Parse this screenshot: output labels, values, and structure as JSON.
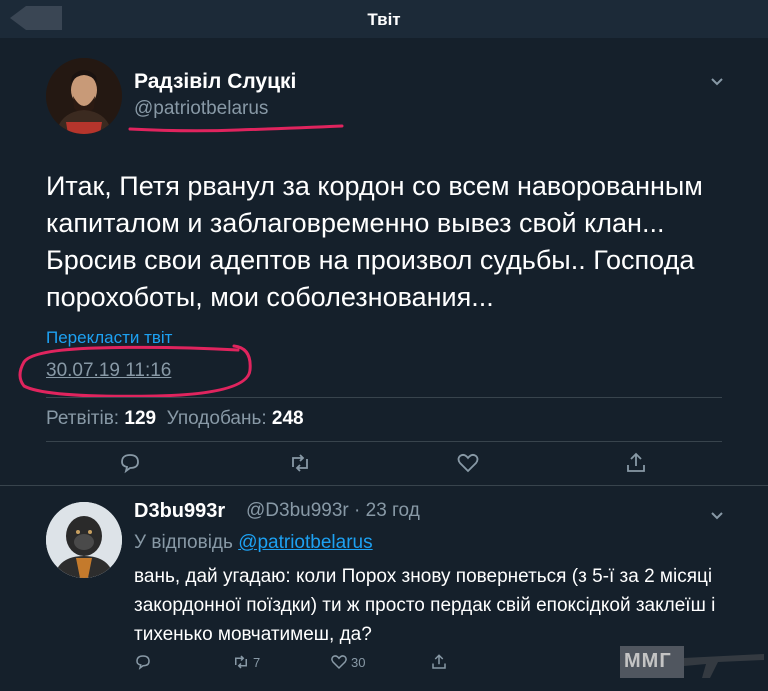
{
  "header": {
    "title": "Твіт"
  },
  "tweet": {
    "author_name": "Радзівіл Слуцкі",
    "author_handle": "@patriotbelarus",
    "text": "Итак, Петя рванул за кордон со всем наворованным капиталом и заблаговременно вывез свой клан... Бросив свои адептов на произвол судьбы.. Господа порохоботы, мои соболезнования...",
    "translate_link": "Перекласти твіт",
    "datetime": "30.07.19 11:16",
    "retweets_label": "Ретвітів:",
    "retweets_count": "129",
    "likes_label": "Уподобань:",
    "likes_count": "248"
  },
  "reply": {
    "author_name": "D3bu993r",
    "author_handle": "@D3bu993r · 23 год",
    "reply_to_prefix": "У відповідь",
    "reply_to_handle": "@patriotbelarus",
    "text": "вань, дай угадаю: коли Порох знову повернеться (з 5-ї за 2 місяці закордонної поїздки) ти ж просто пердак свій епоксідкой заклеїш і тихенько мовчатимеш, да?",
    "retweet_count": "7",
    "like_count": "30"
  },
  "watermark": {
    "text": "ММГ"
  },
  "colors": {
    "background": "#15202b",
    "accent": "#1da1f2",
    "secondary_text": "#8899a6",
    "annotation": "#e0245e"
  },
  "icons": [
    "back-arrow-icon",
    "chevron-down-icon",
    "reply-icon",
    "retweet-icon",
    "like-icon",
    "share-icon"
  ]
}
